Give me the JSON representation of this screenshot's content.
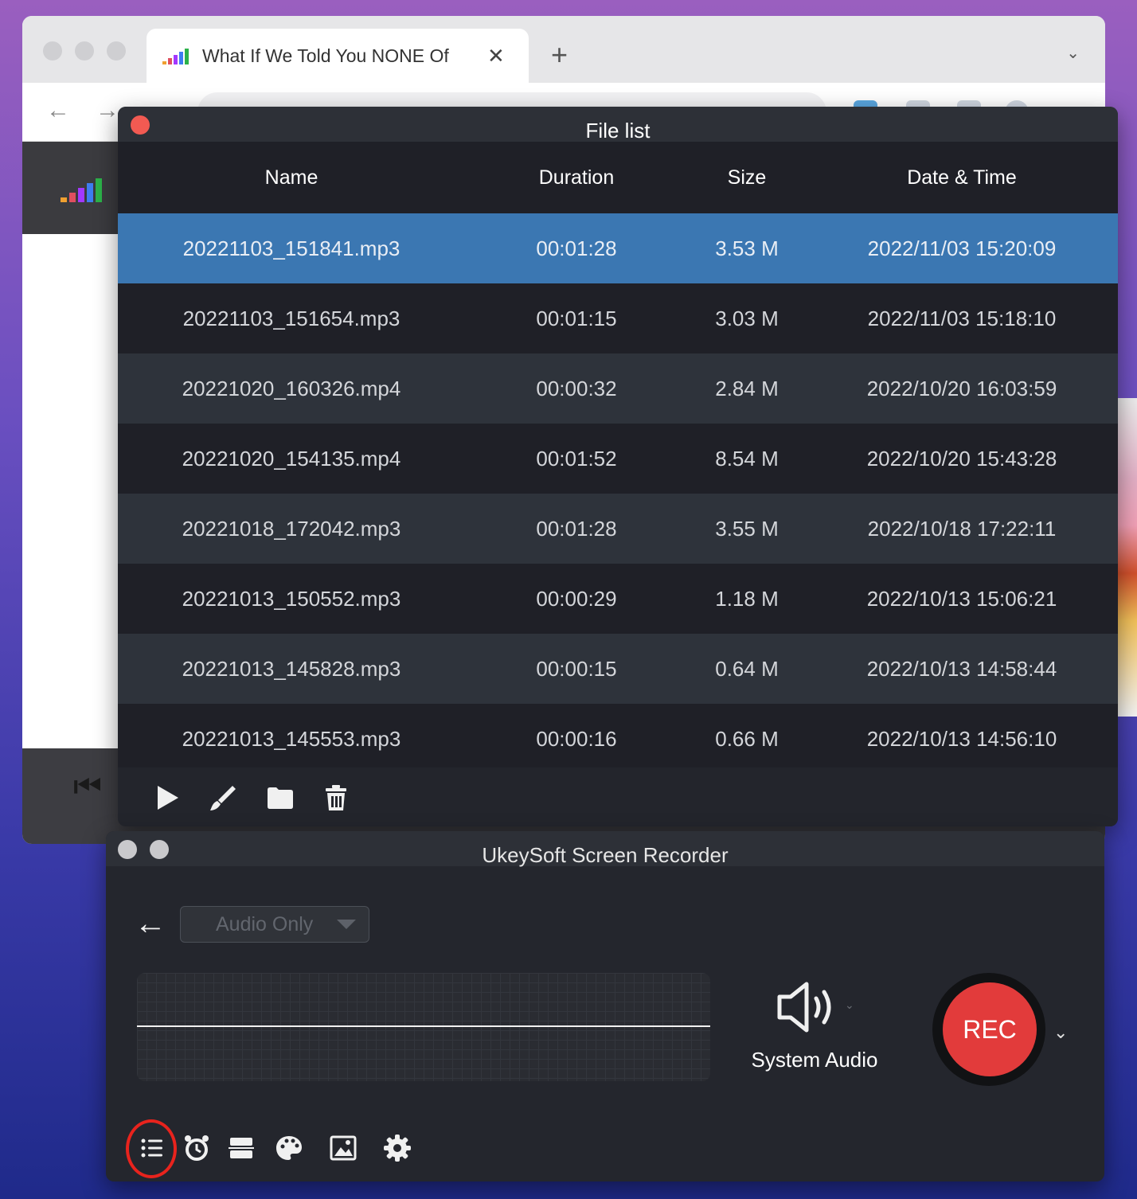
{
  "browser": {
    "tab_title": "What If We Told You NONE Of",
    "tab_close": "✕",
    "new_tab": "+",
    "tab_menu": "⌄",
    "back": "←",
    "forward": "→",
    "player_prev": "⏮"
  },
  "file_list": {
    "title": "File list",
    "columns": [
      "Name",
      "Duration",
      "Size",
      "Date & Time"
    ],
    "rows": [
      {
        "name": "20221103_151841.mp3",
        "duration": "00:01:28",
        "size": "3.53 M",
        "date": "2022/11/03 15:20:09",
        "selected": true
      },
      {
        "name": "20221103_151654.mp3",
        "duration": "00:01:15",
        "size": "3.03 M",
        "date": "2022/11/03 15:18:10"
      },
      {
        "name": "20221020_160326.mp4",
        "duration": "00:00:32",
        "size": "2.84 M",
        "date": "2022/10/20 16:03:59"
      },
      {
        "name": "20221020_154135.mp4",
        "duration": "00:01:52",
        "size": "8.54 M",
        "date": "2022/10/20 15:43:28"
      },
      {
        "name": "20221018_172042.mp3",
        "duration": "00:01:28",
        "size": "3.55 M",
        "date": "2022/10/18 17:22:11"
      },
      {
        "name": "20221013_150552.mp3",
        "duration": "00:00:29",
        "size": "1.18 M",
        "date": "2022/10/13 15:06:21"
      },
      {
        "name": "20221013_145828.mp3",
        "duration": "00:00:15",
        "size": "0.64 M",
        "date": "2022/10/13 14:58:44"
      },
      {
        "name": "20221013_145553.mp3",
        "duration": "00:00:16",
        "size": "0.66 M",
        "date": "2022/10/13 14:56:10"
      }
    ],
    "toolbar_icons": [
      "play-icon",
      "brush-icon",
      "folder-icon",
      "trash-icon"
    ]
  },
  "recorder": {
    "title": "UkeySoft Screen Recorder",
    "back": "←",
    "mode": "Audio Only",
    "audio_source": "System Audio",
    "rec_label": "REC",
    "rec_caret": "⌄",
    "toolbar_icons": [
      "file-list-icon",
      "alarm-clock-icon",
      "segment-icon",
      "palette-icon",
      "image-icon",
      "gear-icon"
    ]
  },
  "colors": {
    "accent_selected_row": "#3b77b2",
    "rec_button": "#e23b3b",
    "close_button": "#f25a52",
    "highlight_circle": "#e8231d"
  }
}
